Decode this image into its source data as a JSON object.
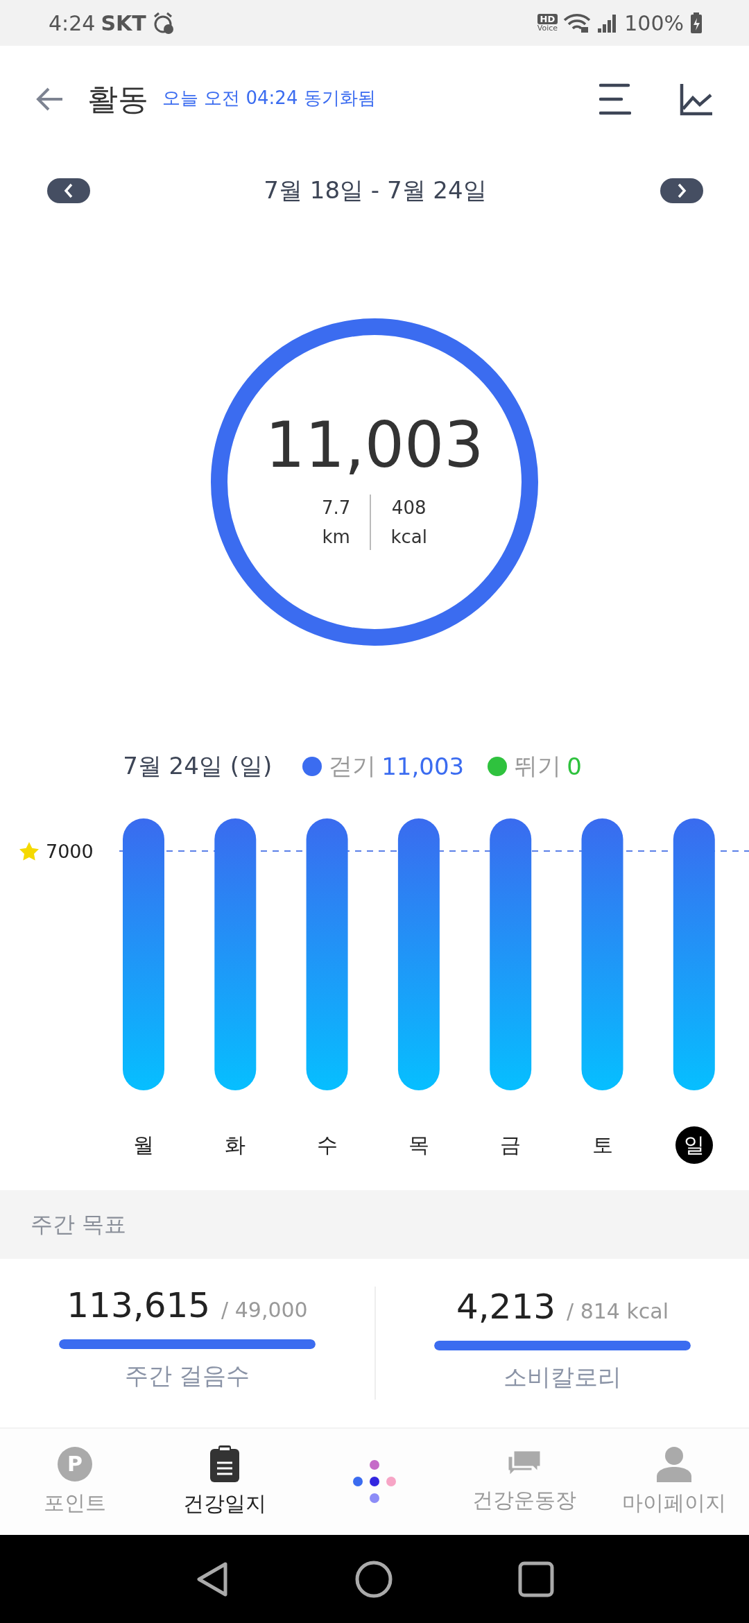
{
  "status_bar": {
    "time": "4:24",
    "carrier": "SKT",
    "hd": "HD",
    "voice": "Voice",
    "battery": "100%"
  },
  "header": {
    "title": "활동",
    "sync": "오늘 오전 04:24 동기화됨"
  },
  "date_nav": {
    "range": "7월 18일 - 7월 24일"
  },
  "ring": {
    "steps": "11,003",
    "level": 1,
    "distance": "7.7",
    "distance_unit": "km",
    "calories": "408",
    "calories_unit": "kcal"
  },
  "legend": {
    "date": "7월 24일 (일)",
    "series": [
      {
        "name": "걷기",
        "value": "11,003",
        "color": "#3b6cf0"
      },
      {
        "name": "뛰기",
        "value": "0",
        "color": "#2fc23e"
      }
    ]
  },
  "chart": {
    "goal_label": "7000",
    "days": [
      {
        "label": "월",
        "selected": false
      },
      {
        "label": "화",
        "selected": false
      },
      {
        "label": "수",
        "selected": false
      },
      {
        "label": "목",
        "selected": false
      },
      {
        "label": "금",
        "selected": false
      },
      {
        "label": "토",
        "selected": false
      },
      {
        "label": "일",
        "selected": true
      }
    ]
  },
  "weekly_goal": {
    "title": "주간 목표",
    "items": [
      {
        "value": "113,615",
        "target": "/ 49,000",
        "level": 1,
        "label": "주간 걸음수"
      },
      {
        "value": "4,213",
        "target": "/ 814 kcal",
        "level": 1,
        "label": "소비칼로리"
      }
    ]
  },
  "bottom_nav": {
    "points_mark": "P",
    "items": [
      {
        "label": "포인트",
        "selected": false
      },
      {
        "label": "건강일지",
        "selected": true
      },
      {
        "label": "건강운동장",
        "selected": false
      },
      {
        "label": "마이페이지",
        "selected": false
      }
    ]
  }
}
